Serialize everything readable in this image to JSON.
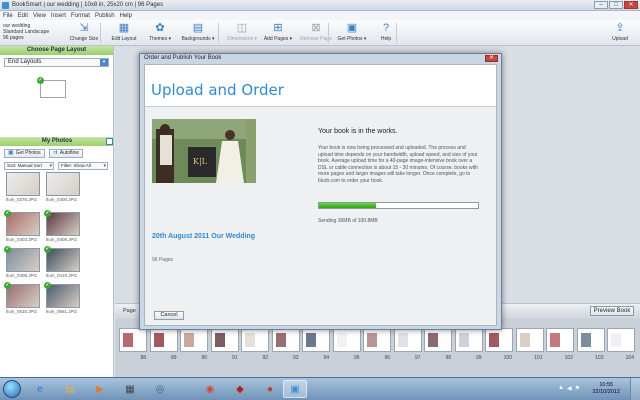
{
  "titlebar": {
    "title": "BookSmart | our wedding | 10x8 in, 25x20 cm | 96 Pages",
    "minimize": "–",
    "maximize": "□",
    "close": "✕"
  },
  "menu": [
    "File",
    "Edit",
    "View",
    "Insert",
    "Format",
    "Publish",
    "Help"
  ],
  "book_info": {
    "name": "our wedding",
    "format": "Standard Landscape",
    "pages": "96 pages"
  },
  "toolbar": [
    {
      "label": "Change Size",
      "icon": "resize-icon",
      "glyph": "⇲",
      "disabled": false
    },
    {
      "label": "Edit Layout",
      "icon": "layout-icon",
      "glyph": "▦",
      "disabled": false
    },
    {
      "label": "Themes ▾",
      "icon": "themes-icon",
      "glyph": "✿",
      "disabled": false
    },
    {
      "label": "Backgrounds ▾",
      "icon": "backgrounds-icon",
      "glyph": "▤",
      "disabled": false
    },
    {
      "label": "Dimensions ▾",
      "icon": "dimensions-icon",
      "glyph": "◫",
      "disabled": true
    },
    {
      "label": "Add Pages ▾",
      "icon": "add-pages-icon",
      "glyph": "⊞",
      "disabled": false
    },
    {
      "label": "Remove Page",
      "icon": "remove-page-icon",
      "glyph": "⊠",
      "disabled": true
    },
    {
      "label": "Get Photos ▾",
      "icon": "get-photos-icon",
      "glyph": "▣",
      "disabled": false
    },
    {
      "label": "Help",
      "icon": "help-icon",
      "glyph": "?",
      "disabled": false
    }
  ],
  "upload_label": "Upload",
  "left_panel": {
    "layout_header": "Choose Page Layout",
    "layout_dropdown": "End Layouts",
    "photos_header": "My Photos",
    "get_photos": "Get Photos",
    "autoflow": "Autoflow",
    "sort": "Sort: Manual Sort",
    "filter": "Filter: Show All",
    "photos": [
      {
        "name": "Ilum_0376.JPG",
        "color": "#e9ecef",
        "used": false
      },
      {
        "name": "Ilum_0400.JPG",
        "color": "#e9ecef",
        "used": false
      },
      {
        "name": "Ilum_0403.JPG",
        "color": "#a86d6a",
        "used": true
      },
      {
        "name": "Ilum_0408.JPG",
        "color": "#5b3a3f",
        "used": true
      },
      {
        "name": "Ilum_0409.JPG",
        "color": "#7b8d9f",
        "used": true
      },
      {
        "name": "Ilum_0410.JPG",
        "color": "#3e4d5e",
        "used": true
      },
      {
        "name": "Ilum_0515.JPG",
        "color": "#9a6e72",
        "used": true
      },
      {
        "name": "Ilum_0561.JPG",
        "color": "#4c5a70",
        "used": true
      }
    ]
  },
  "workspace": {
    "spread_label": "Page",
    "preview_button": "Preview Book",
    "page_numbers": [
      "88",
      "89",
      "90",
      "91",
      "92",
      "93",
      "94",
      "95",
      "96",
      "97",
      "98",
      "99",
      "100",
      "101",
      "102",
      "103",
      "104"
    ]
  },
  "dialog": {
    "window_title": "Order and Publish Your Book",
    "heading": "Upload and Order",
    "book_title": "20th August 2011 Our Wedding",
    "page_count": "96 Pages",
    "status_heading": "Your book is in the works.",
    "body": "Your book is now being processed and uploaded. The process and upload time depends on your bandwidth, upload speed, and size of your book. Average upload time for a 40-page image-intensive book over a DSL or cable connection is about 15 - 30 minutes. Of course, books with more pages and larger images will take longer. Once complete, go to blurb.com to order your book.",
    "progress": 0.36,
    "sending": "Sending 36MB of 100.8MB",
    "cancel": "Cancel",
    "accent": "#2e8bd0"
  },
  "taskbar": {
    "time": "10:55",
    "date": "22/10/2012",
    "apps": [
      {
        "name": "ie-icon",
        "glyph": "e",
        "color": "#2b7bd0"
      },
      {
        "name": "explorer-icon",
        "glyph": "▤",
        "color": "#e2b64a"
      },
      {
        "name": "media-player-icon",
        "glyph": "▶",
        "color": "#e07a2e"
      },
      {
        "name": "filmstrip-icon",
        "glyph": "▦",
        "color": "#444"
      },
      {
        "name": "app-icon-1",
        "glyph": "◎",
        "color": "#3a5f8a"
      },
      {
        "name": "chrome-icon",
        "glyph": "◉",
        "color": "#d64532"
      },
      {
        "name": "app-icon-2",
        "glyph": "◆",
        "color": "#b51f1f"
      },
      {
        "name": "app-icon-3",
        "glyph": "●",
        "color": "#c23a3a"
      },
      {
        "name": "booksmart-icon",
        "glyph": "▣",
        "color": "#3b8fd6"
      }
    ]
  }
}
